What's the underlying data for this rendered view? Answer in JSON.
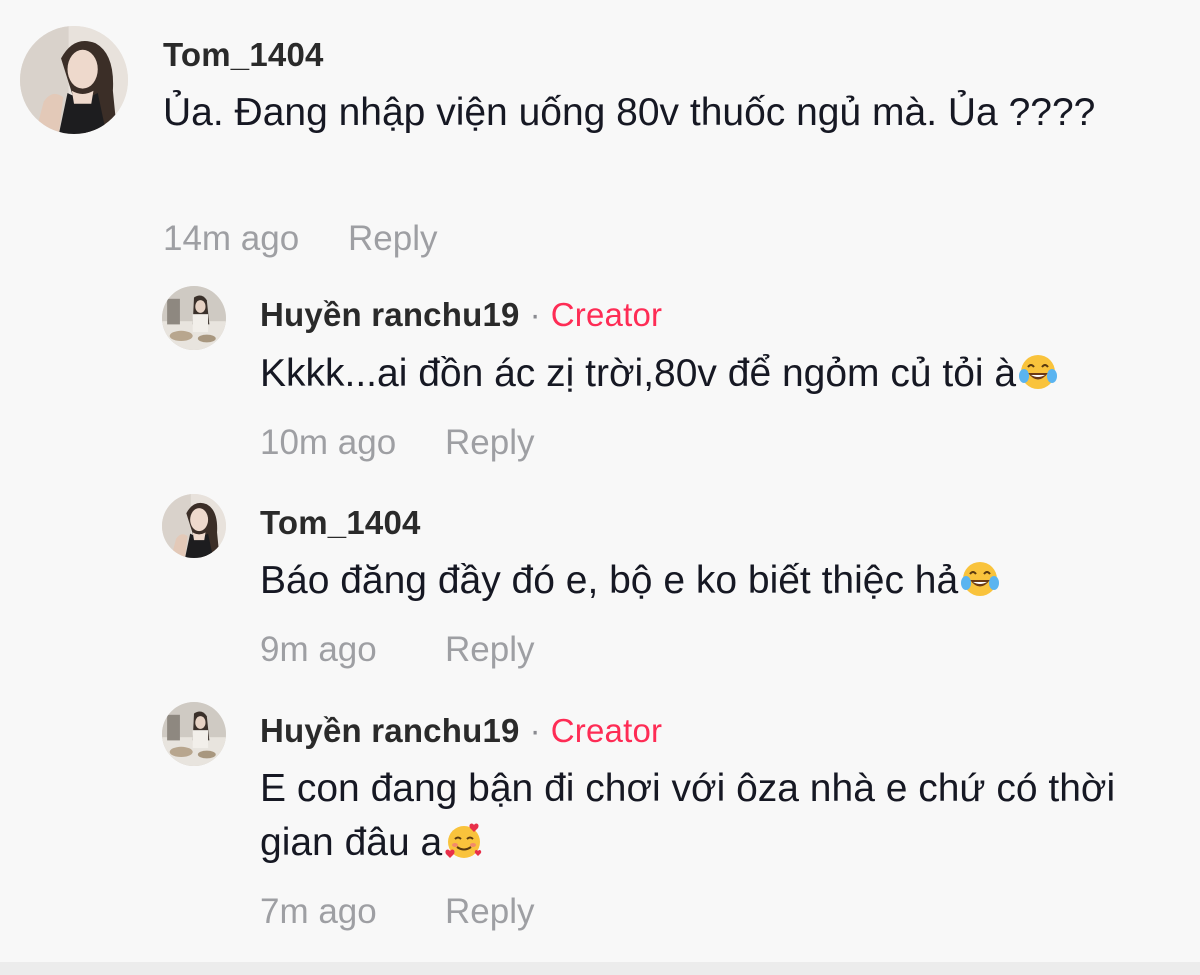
{
  "comments": [
    {
      "username": "Tom_1404",
      "text": "Ủa. Đang nhập viện uống 80v thuốc ngủ mà. Ủa ????",
      "time": "14m ago",
      "reply_label": "Reply",
      "avatar_icon": "user-avatar-woman"
    }
  ],
  "replies": [
    {
      "username": "Huyền ranchu19",
      "separator": "·",
      "badge": "Creator",
      "text": "Kkkk...ai đồn ác zị trời,80v để ngỏm củ tỏi à",
      "emoji": "tears-of-joy-emoji",
      "time": "10m ago",
      "reply_label": "Reply"
    },
    {
      "username": "Tom_1404",
      "text": "Báo đăng đầy đó e, bộ e ko biết thiệc hả",
      "emoji": "tears-of-joy-emoji",
      "time": "9m ago",
      "reply_label": "Reply"
    },
    {
      "username": "Huyền ranchu19",
      "separator": "·",
      "badge": "Creator",
      "text": "E con đang bận đi chơi với ôza nhà e chứ có thời gian đâu a",
      "emoji": "smiling-face-with-hearts-emoji",
      "time": "7m ago",
      "reply_label": "Reply"
    }
  ],
  "colors": {
    "background": "#f8f8f8",
    "creator_badge": "#fe2c55",
    "meta_text": "#9e9fa3",
    "body_text": "#161823"
  }
}
